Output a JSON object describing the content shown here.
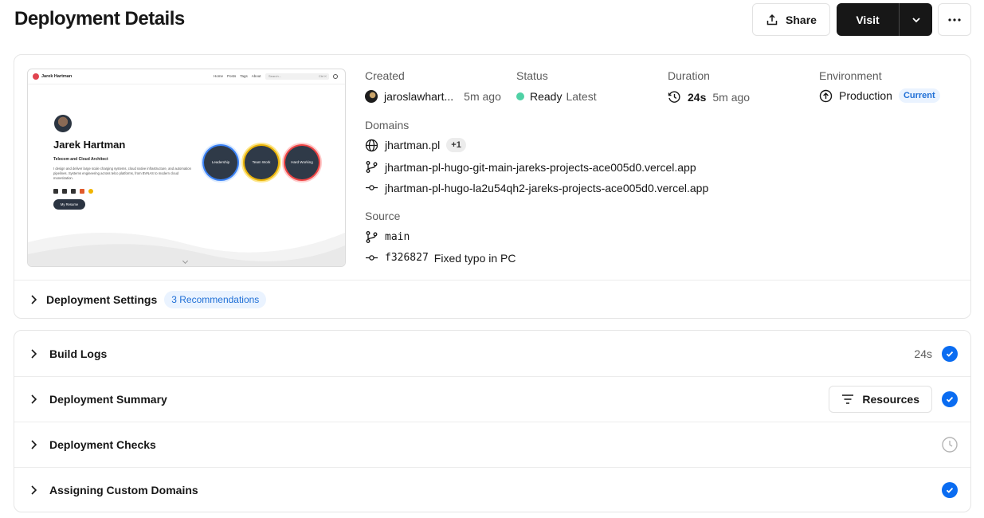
{
  "header": {
    "title": "Deployment Details",
    "share_label": "Share",
    "visit_label": "Visit"
  },
  "preview": {
    "brand": "Jarek Hartman",
    "nav_links": [
      "Home",
      "Posts",
      "Tags",
      "About"
    ],
    "search_placeholder": "Search...",
    "search_shortcut": "Ctrl K",
    "name": "Jarek Hartman",
    "subtitle": "Telecom and Cloud Architect",
    "description": "I design and deliver large scale charging systems, cloud native infrastructure, and automation pipelines. Systems engineering across telco platforms, from BVNAS to modern cloud monetization.",
    "resume_label": "My Resume",
    "circles": [
      "Leadership",
      "Team Work",
      "Hard Working"
    ]
  },
  "info": {
    "created_label": "Created",
    "created_user": "jaroslawhart...",
    "created_time": "5m ago",
    "status_label": "Status",
    "status_value": "Ready",
    "status_tag": "Latest",
    "status_color": "#4fd1a5",
    "duration_label": "Duration",
    "duration_value": "24s",
    "duration_time": "5m ago",
    "environment_label": "Environment",
    "environment_value": "Production",
    "environment_badge": "Current",
    "domains_label": "Domains",
    "domain_primary": "jhartman.pl",
    "domain_extra_count": "+1",
    "domain_branch": "jhartman-pl-hugo-git-main-jareks-projects-ace005d0.vercel.app",
    "domain_commit": "jhartman-pl-hugo-la2u54qh2-jareks-projects-ace005d0.vercel.app",
    "source_label": "Source",
    "source_branch": "main",
    "source_sha": "f326827",
    "source_message": "Fixed typo in PC"
  },
  "settings": {
    "label": "Deployment Settings",
    "recommendations": "3 Recommendations"
  },
  "steps": [
    {
      "label": "Build Logs",
      "time": "24s",
      "state": "done"
    },
    {
      "label": "Deployment Summary",
      "action": "Resources",
      "state": "done"
    },
    {
      "label": "Deployment Checks",
      "state": "pending"
    },
    {
      "label": "Assigning Custom Domains",
      "state": "done"
    }
  ],
  "colors": {
    "accent": "#0a6cf1",
    "badge_bg": "#eaf3ff",
    "badge_text": "#1f6fd6"
  }
}
